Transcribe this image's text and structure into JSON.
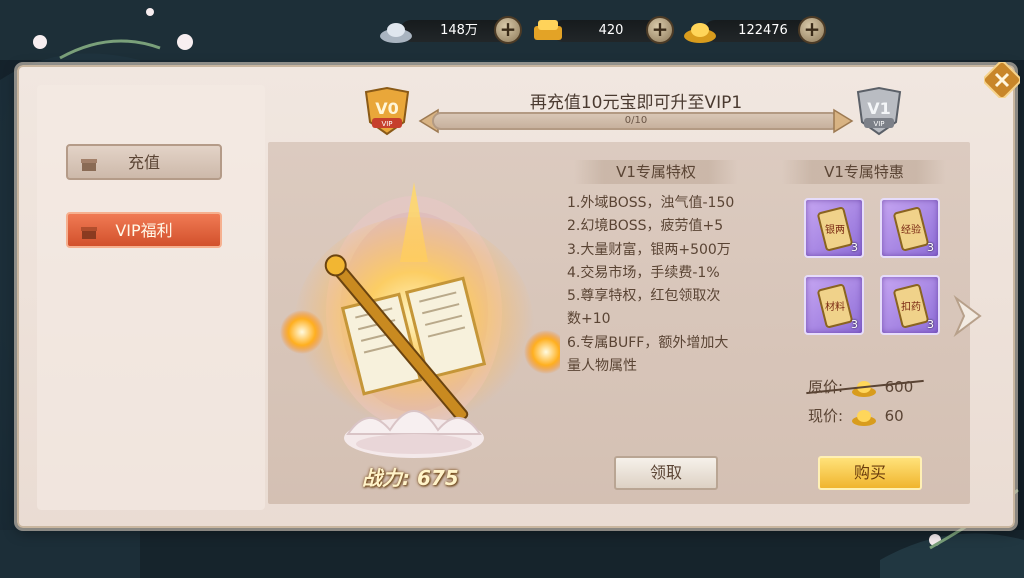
{
  "currency": [
    {
      "name": "silver",
      "value": "148万"
    },
    {
      "name": "yuanbao",
      "value": "420"
    },
    {
      "name": "gold",
      "value": "122476"
    }
  ],
  "sidebar": {
    "items": [
      {
        "label": "充值",
        "active": false
      },
      {
        "label": "VIP福利",
        "active": true
      }
    ]
  },
  "header": {
    "title": "再充值10元宝即可升至VIP1",
    "progress_text": "0/10",
    "progress_fraction": 0,
    "current_vip": "V0",
    "next_vip": "V1",
    "vip_sub": "VIP"
  },
  "showcase": {
    "power": "战力: 675"
  },
  "privileges": {
    "title": "V1专属特权",
    "lines": [
      "1.外域BOSS，浊气值-150",
      "2.幻境BOSS，疲劳值+5",
      "3.大量财富，银两+500万",
      "4.交易市场，手续费-1%",
      "5.尊享特权，红包领取次",
      "数+10",
      "6.专属BUFF，额外增加大",
      "量人物属性"
    ]
  },
  "deals": {
    "title": "V1专属特惠",
    "items": [
      {
        "text": "银两",
        "count": "3"
      },
      {
        "text": "经验",
        "count": "3"
      },
      {
        "text": "材料",
        "count": "3"
      },
      {
        "text": "扣药",
        "count": "3"
      }
    ],
    "original_label": "原价:",
    "original_price": "600",
    "current_label": "现价:",
    "current_price": "60"
  },
  "buttons": {
    "claim": "领取",
    "buy": "购买"
  },
  "colors": {
    "accent": "#e4643a",
    "item_bg": "#a98ae6",
    "buy_gold": "#f0b52e"
  }
}
